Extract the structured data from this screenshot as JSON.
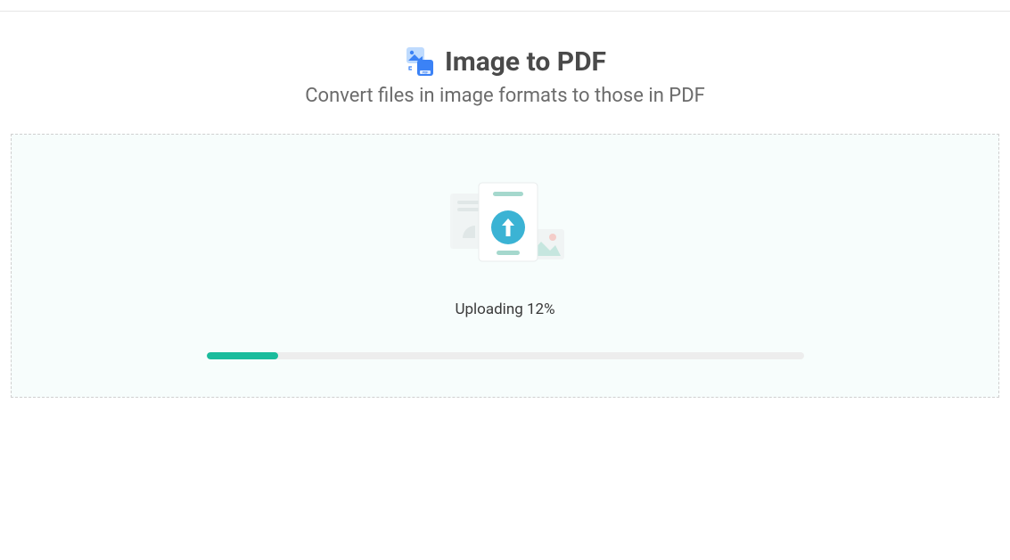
{
  "header": {
    "title": "Image to PDF",
    "subtitle": "Convert files in image formats to those in PDF"
  },
  "upload": {
    "status_prefix": "Uploading",
    "percent_value": 12,
    "percent_display": "12%",
    "status_full": "Uploading 12%",
    "progress_width": "12%"
  },
  "colors": {
    "accent": "#1abc9c",
    "logo_blue": "#3b82f6",
    "logo_light": "#bfdbfe",
    "illustration_teal": "#66c8b6",
    "illustration_circle": "#3bb3d4"
  }
}
